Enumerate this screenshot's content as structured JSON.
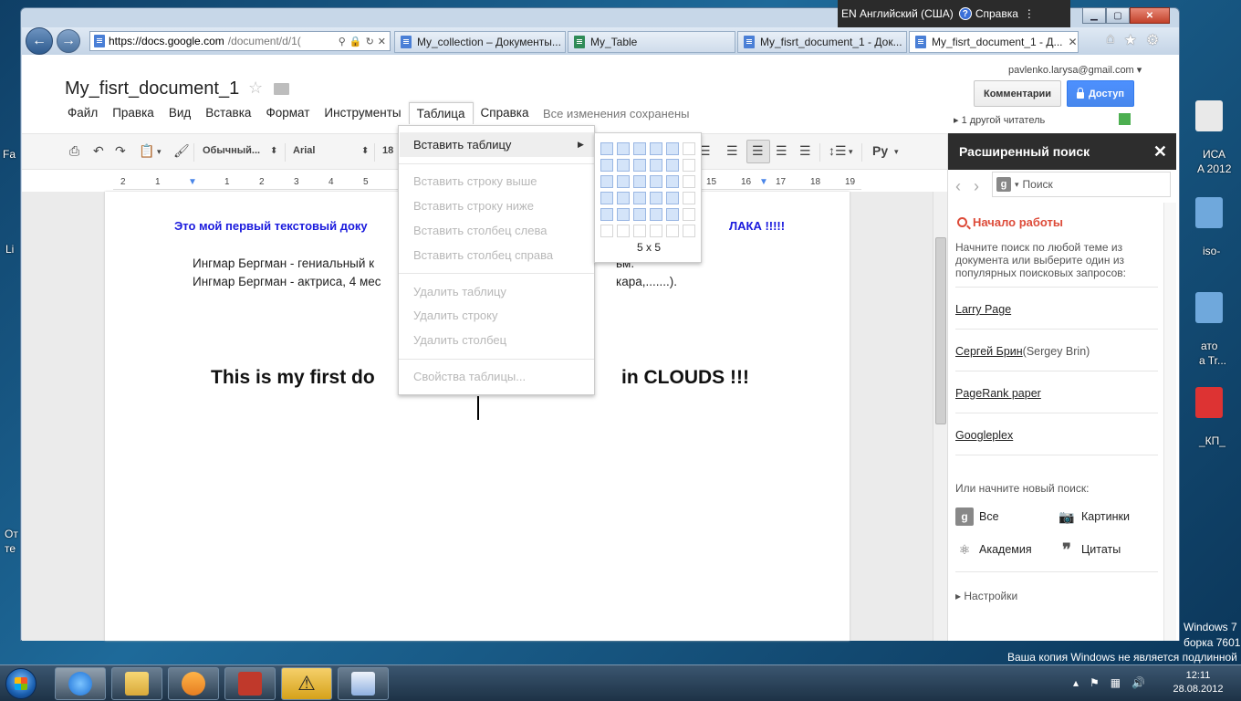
{
  "browser": {
    "lang_indicator": "EN Английский (США)",
    "help_label": "Справка",
    "url_host": "https://docs.google.com",
    "url_rest": "/document/d/1(",
    "tabs": [
      {
        "label": "My_collection – Документы..."
      },
      {
        "label": "My_Table"
      },
      {
        "label": "My_fisrt_document_1 - Док..."
      },
      {
        "label": "My_fisrt_document_1 - Д..."
      }
    ]
  },
  "doc": {
    "title": "My_fisrt_document_1",
    "menu": [
      "Файл",
      "Правка",
      "Вид",
      "Вставка",
      "Формат",
      "Инструменты",
      "Таблица",
      "Справка"
    ],
    "saved_status": "Все изменения сохранены",
    "account": "pavlenko.larysa@gmail.com",
    "comments_label": "Комментарии",
    "share_label": "Доступ",
    "viewers": "1 другой читатель",
    "toolbar": {
      "style_select": "Обычный...",
      "font_select": "Arial",
      "size_select": "18",
      "lang_select": "Ру"
    },
    "ruler": [
      "2",
      "1",
      "1",
      "2",
      "3",
      "4",
      "5",
      "15",
      "16",
      "17",
      "18",
      "19"
    ],
    "content": {
      "blue_left": "Это мой первый текстовый доку",
      "blue_right": "ЛАКА !!!!!",
      "line1_left": "Ингмар Бергман - гениальный к",
      "line1_right": "ьм.",
      "line2_left": "Ингмар Бергман - актриса, 4 мес",
      "line2_right": "кара,.......).",
      "big_left": "This is my first do",
      "big_right": "in CLOUDS !!!"
    }
  },
  "table_menu": {
    "insert_table": "Вставить таблицу",
    "insert_row_above": "Вставить строку выше",
    "insert_row_below": "Вставить строку ниже",
    "insert_col_left": "Вставить столбец слева",
    "insert_col_right": "Вставить столбец справа",
    "delete_table": "Удалить таблицу",
    "delete_row": "Удалить строку",
    "delete_col": "Удалить столбец",
    "table_props": "Свойства таблицы...",
    "grid_size": "5 x 5"
  },
  "research": {
    "title": "Расширенный поиск",
    "search_placeholder": "Поиск",
    "start_title": "Начало работы",
    "start_desc": "Начните поиск по любой теме из документа или выберите один из популярных поисковых запросов:",
    "links": [
      {
        "label": "Larry Page",
        "sub": ""
      },
      {
        "label": "Сергей Брин",
        "sub": " (Sergey Brin)"
      },
      {
        "label": "PageRank paper",
        "sub": ""
      },
      {
        "label": "Googleplex",
        "sub": ""
      }
    ],
    "new_search": "Или начните новый поиск:",
    "categories": {
      "all": "Все",
      "images": "Картинки",
      "scholar": "Академия",
      "quotes": "Цитаты"
    },
    "settings": "Настройки"
  },
  "desktop": {
    "left_labels": [
      "Fa",
      "Li",
      "От",
      "те"
    ],
    "right_labels": [
      "ИСА",
      "A 2012",
      "iso-",
      "ато",
      "a Tr...",
      "_КП_"
    ],
    "win_build_1": "Windows 7",
    "win_build_2": "борка 7601",
    "activation": "Ваша копия Windows не является подлинной"
  },
  "taskbar": {
    "time": "12:11",
    "date": "28.08.2012"
  },
  "colors": {
    "share_blue": "#4d90fe",
    "research_red": "#dd4b39",
    "heading_blue": "#1a1add"
  }
}
